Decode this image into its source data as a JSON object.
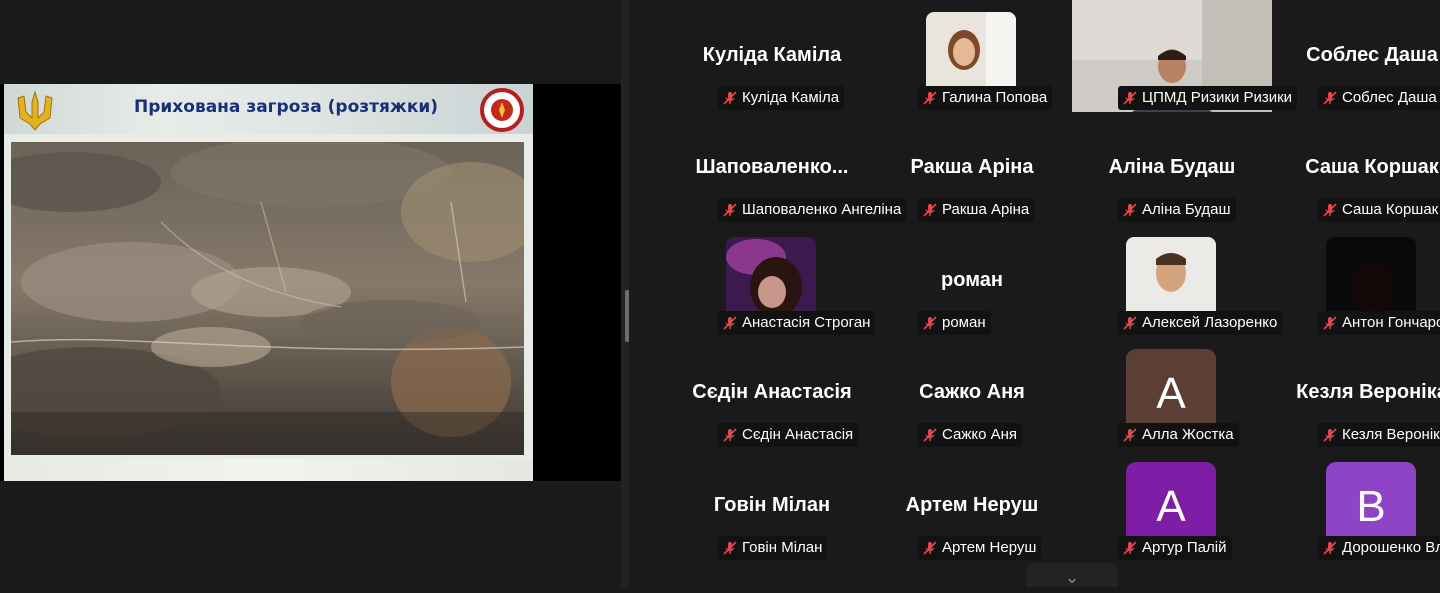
{
  "share": {
    "slide_title": "Прихована загроза (розтяжки)"
  },
  "gallery": {
    "tiles": [
      {
        "name": "Куліда Каміла",
        "label": "Куліда Каміла",
        "type": "name"
      },
      {
        "name": "",
        "label": "Галина Попова",
        "type": "photo"
      },
      {
        "name": "",
        "label": "ЦПМД Ризики Ризики",
        "type": "video",
        "active": true
      },
      {
        "name": "Соблес Даша",
        "label": "Соблес Даша",
        "type": "name"
      },
      {
        "name": "Шаповаленко...",
        "label": "Шаповаленко Ангеліна",
        "type": "name"
      },
      {
        "name": "Ракша Аріна",
        "label": "Ракша Аріна",
        "type": "name"
      },
      {
        "name": "Аліна Будаш",
        "label": "Аліна Будаш",
        "type": "name"
      },
      {
        "name": "Саша Коршак",
        "label": "Саша Коршак",
        "type": "name"
      },
      {
        "name": "",
        "label": "Анастасія Строган",
        "type": "photo"
      },
      {
        "name": "роман",
        "label": "роман",
        "type": "name"
      },
      {
        "name": "",
        "label": "Алексей Лазоренко",
        "type": "photo"
      },
      {
        "name": "",
        "label": "Антон Гончаров",
        "type": "photo"
      },
      {
        "name": "Сєдін Анастасія",
        "label": "Сєдін Анастасія",
        "type": "name"
      },
      {
        "name": "Сажко Аня",
        "label": "Сажко Аня",
        "type": "name"
      },
      {
        "name": "",
        "label": "Алла Жостка",
        "type": "letter",
        "letter": "A",
        "color": "#5b3f34"
      },
      {
        "name": "Кезля Вероніка",
        "label": "Кезля Вероніка",
        "type": "name"
      },
      {
        "name": "Говін Мілан",
        "label": "Говін Мілан",
        "type": "name"
      },
      {
        "name": "Артем Неруш",
        "label": "Артем Неруш",
        "type": "name"
      },
      {
        "name": "",
        "label": "Артур Палій",
        "type": "letter",
        "letter": "A",
        "color": "#7e1ea6"
      },
      {
        "name": "",
        "label": "Дорошенко Владислав",
        "type": "letter",
        "letter": "B",
        "color": "#8e44c4"
      }
    ],
    "icons": {
      "mic": "microphone-muted-icon",
      "chevron": "chevron-down-icon"
    },
    "colors": {
      "muted_mic": "#e0474a",
      "active_speaker": "#23d959"
    }
  }
}
